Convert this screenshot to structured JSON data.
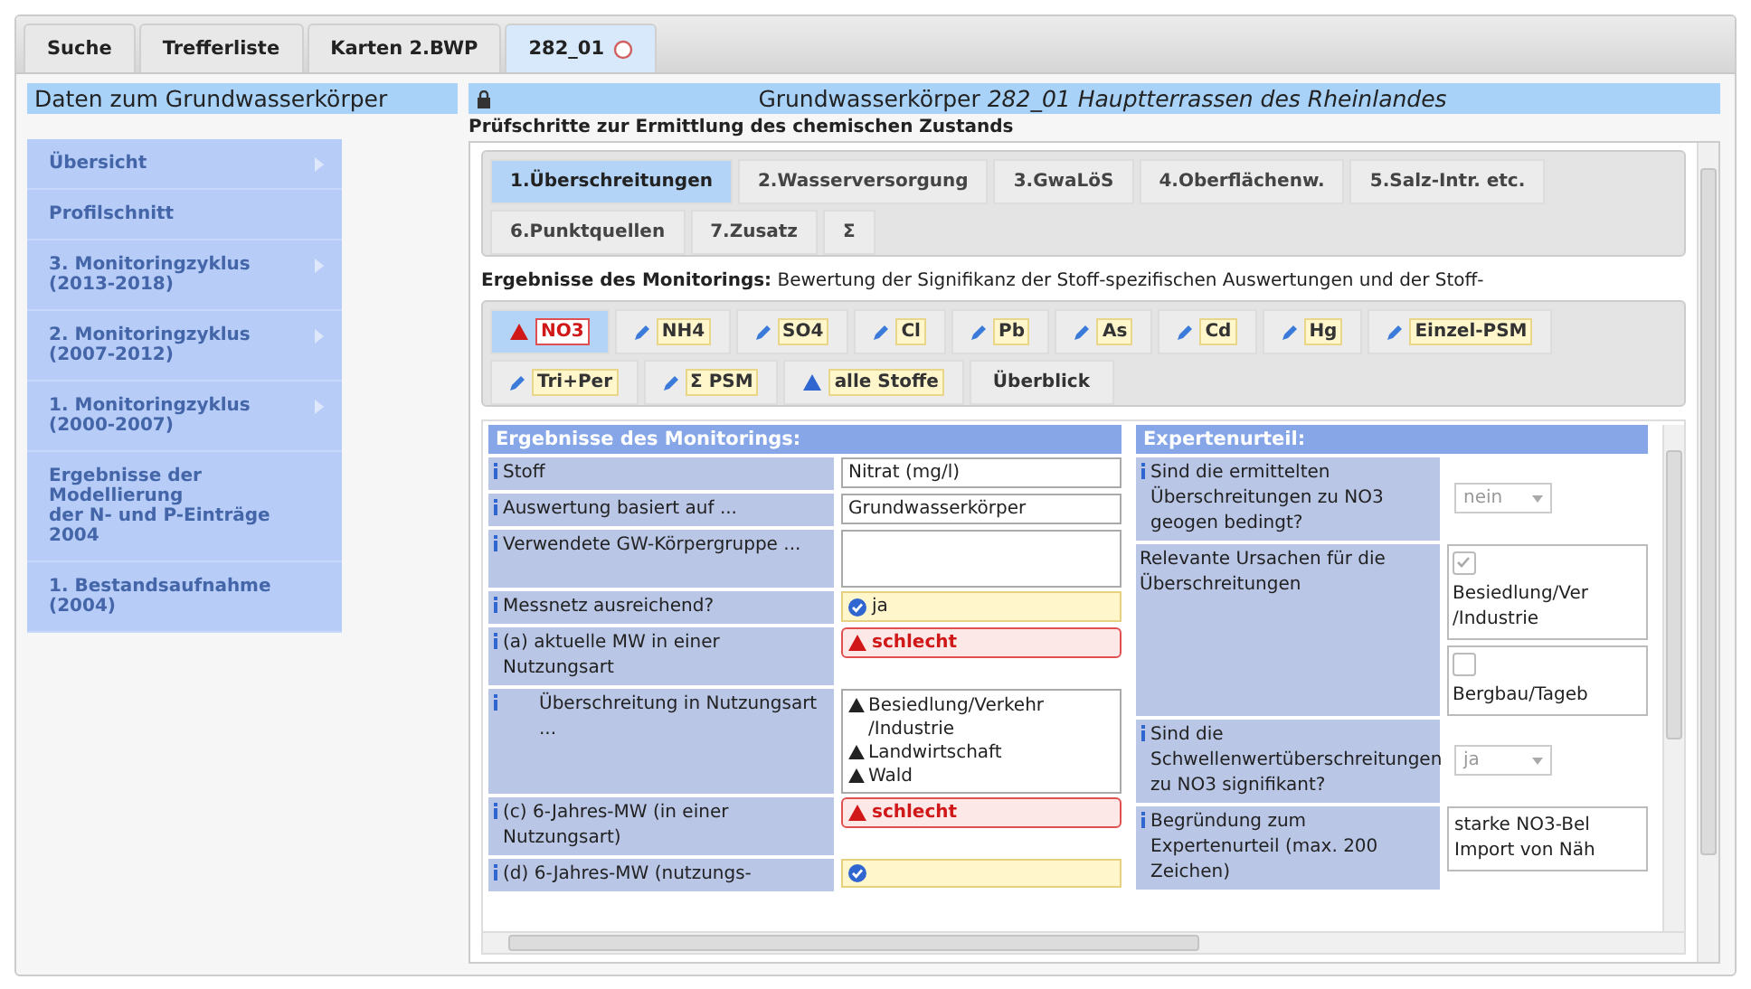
{
  "tabs": [
    {
      "label": "Suche",
      "selected": false,
      "closable": false
    },
    {
      "label": "Trefferliste",
      "selected": false,
      "closable": false
    },
    {
      "label": "Karten 2.BWP",
      "selected": false,
      "closable": false
    },
    {
      "label": "282_01",
      "selected": true,
      "closable": true
    }
  ],
  "sidebar": {
    "title": "Daten zum Grundwasserkörper",
    "items": [
      {
        "label": "Übersicht",
        "has_submenu": true
      },
      {
        "label": "Profilschnitt",
        "has_submenu": false
      },
      {
        "label": "3. Monitoringzyklus\n(2013-2018)",
        "has_submenu": true
      },
      {
        "label": "2. Monitoringzyklus\n(2007-2012)",
        "has_submenu": true
      },
      {
        "label": "1. Monitoringzyklus\n(2000-2007)",
        "has_submenu": true
      },
      {
        "label": "Ergebnisse der\nModellierung\nder N- und P-Einträge\n2004",
        "has_submenu": false
      },
      {
        "label": "1. Bestandsaufnahme\n(2004)",
        "has_submenu": false
      }
    ]
  },
  "main": {
    "title": "Grundwasserkörper *282_01 Hauptterrassen des Rheinlandes*",
    "subtitle": "Prüfschritte zur Ermittlung des chemischen Zustands",
    "step_tabs": [
      {
        "label": "1.Überschreitungen",
        "selected": true
      },
      {
        "label": "2.Wasserversorgung",
        "selected": false
      },
      {
        "label": "3.GwaLöS",
        "selected": false
      },
      {
        "label": "4.Oberflächenw.",
        "selected": false
      },
      {
        "label": "5.Salz-Intr. etc.",
        "selected": false
      },
      {
        "label": "6.Punktquellen",
        "selected": false
      },
      {
        "label": "7.Zusatz",
        "selected": false
      },
      {
        "label": "Σ",
        "selected": false
      }
    ],
    "intro": "**Ergebnisse des Monitorings:** Bewertung der Signifikanz der Stoff-spezifischen Auswertungen und der Stoff-",
    "substance_tabs": [
      {
        "label": "NO3",
        "selected": true,
        "kind": "alert"
      },
      {
        "label": "NH4",
        "selected": false,
        "kind": "edit"
      },
      {
        "label": "SO4",
        "selected": false,
        "kind": "edit"
      },
      {
        "label": "Cl",
        "selected": false,
        "kind": "edit"
      },
      {
        "label": "Pb",
        "selected": false,
        "kind": "edit"
      },
      {
        "label": "As",
        "selected": false,
        "kind": "edit"
      },
      {
        "label": "Cd",
        "selected": false,
        "kind": "edit"
      },
      {
        "label": "Hg",
        "selected": false,
        "kind": "edit"
      },
      {
        "label": "Einzel-PSM",
        "selected": false,
        "kind": "edit"
      },
      {
        "label": "Tri+Per",
        "selected": false,
        "kind": "edit"
      },
      {
        "label": "Σ PSM",
        "selected": false,
        "kind": "edit"
      },
      {
        "label": "alle Stoffe",
        "selected": false,
        "kind": "info"
      },
      {
        "label": "Überblick",
        "selected": false,
        "kind": "plain"
      }
    ],
    "monitoring": {
      "heading": "Ergebnisse des Monitorings:",
      "rows": [
        {
          "label": "Stoff",
          "kind": "text",
          "value": "Nitrat (mg/l)"
        },
        {
          "label": "Auswertung basiert auf ...",
          "kind": "text",
          "value": "Grundwasserkörper"
        },
        {
          "label": "Verwendete GW-Körpergruppe ...",
          "kind": "empty"
        },
        {
          "label": "Messnetz ausreichend?",
          "kind": "ok",
          "value": "ja"
        },
        {
          "label": "(a) aktuelle MW in einer Nutzungsart",
          "kind": "bad",
          "value": "schlecht"
        },
        {
          "label": "Überschreitung in Nutzungsart ...",
          "kind": "list",
          "values": [
            "Besiedlung/Verkehr\n/Industrie",
            "Landwirtschaft",
            "Wald"
          ]
        },
        {
          "label": "(c) 6-Jahres-MW (in einer Nutzungsart)",
          "kind": "bad",
          "value": "schlecht"
        },
        {
          "label": "(d) 6-Jahres-MW (nutzungs-",
          "kind": "ok",
          "value": ""
        }
      ]
    },
    "expert": {
      "heading": "Expertenurteil:",
      "rows": [
        {
          "label": "Sind die ermittelten Überschreitungen zu NO3 geogen bedingt?",
          "info": true,
          "kind": "select",
          "value": "nein"
        },
        {
          "label": "Relevante Ursachen für die Überschreitungen",
          "info": false,
          "kind": "checks",
          "options": [
            {
              "label": "Besiedlung/Ver\n/Industrie",
              "checked": true
            },
            {
              "label": "Bergbau/Tageb",
              "checked": false
            }
          ]
        },
        {
          "label": "Sind die Schwellenwertüberschreitungen zu NO3 signifikant?",
          "info": true,
          "kind": "select",
          "value": "ja"
        },
        {
          "label": "Begründung zum Expertenurteil (max. 200 Zeichen)",
          "info": true,
          "kind": "textarea",
          "value": "starke NO3-Bel\nImport von Näh"
        }
      ]
    }
  }
}
